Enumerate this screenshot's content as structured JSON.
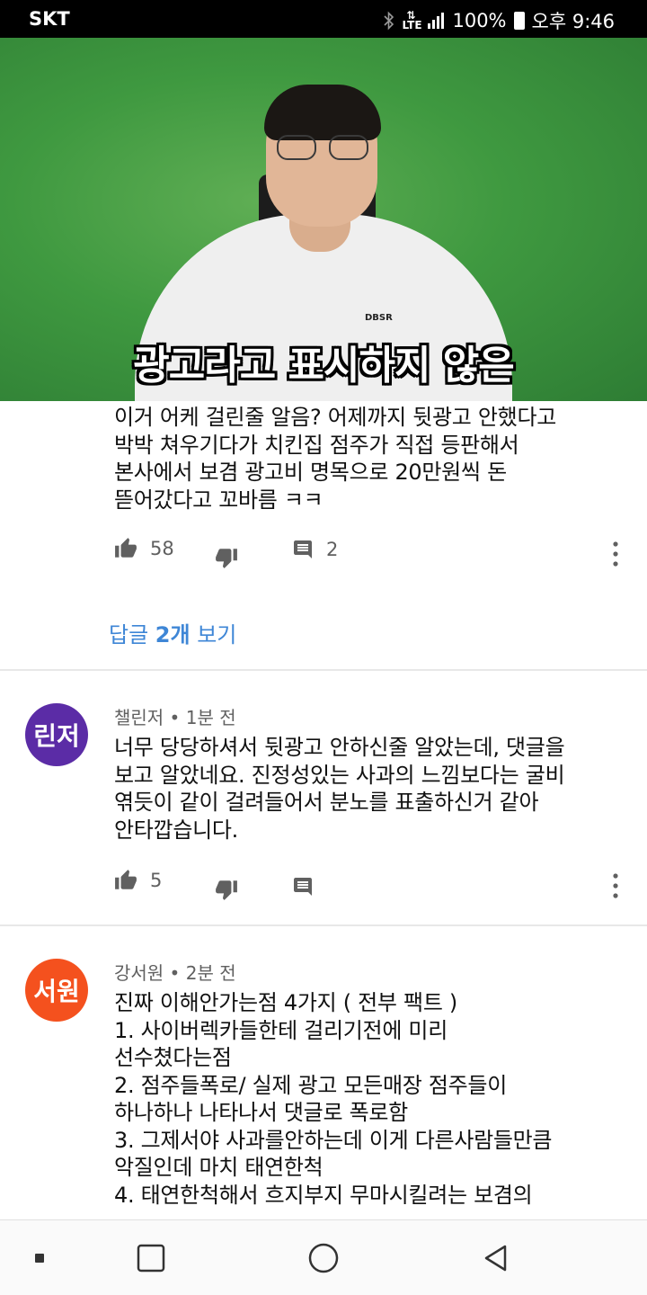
{
  "status_bar": {
    "carrier": "SKT",
    "battery": "100%",
    "time": "오후 9:46"
  },
  "video": {
    "caption": "광고라고 표시하지 않은",
    "shirt_logo": "DBSR",
    "progress_fraction": 0.08,
    "progress_color": "#ff0000"
  },
  "comments": [
    {
      "avatar_icon": "frog-avatar-icon",
      "text": "이거 어케 걸린줄 알음? 어제까지 뒷광고 안했다고\n박박 쳐우기다가 치킨집 점주가 직접 등판해서\n본사에서 보겸 광고비 명목으로 20만원씩 돈\n뜯어갔다고 꼬바름 ㅋㅋ",
      "likes": "58",
      "replies_count": "2",
      "view_replies_prefix": "답글 ",
      "view_replies_count": "2개",
      "view_replies_suffix": " 보기"
    },
    {
      "avatar_text": "린저",
      "avatar_color": "#5b2ca6",
      "author": "챌린저",
      "age": "1분 전",
      "text": "너무 당당하셔서 뒷광고 안하신줄 알았는데, 댓글을\n보고 알았네요. 진정성있는 사과의 느낌보다는 굴비\n엮듯이 같이 걸려들어서 분노를 표출하신거 같아\n안타깝습니다.",
      "likes": "5"
    },
    {
      "avatar_text": "서원",
      "avatar_color": "#f4511e",
      "author": "강서원",
      "age": "2분 전",
      "text": "진짜 이해안가는점 4가지 ( 전부 팩트 )\n1. 사이버렉카들한테 걸리기전에 미리\n선수쳤다는점\n2. 점주들폭로/ 실제 광고 모든매장 점주들이\n하나하나 나타나서 댓글로 폭로함\n3. 그제서야 사과를안하는데 이게 다른사람들만큼\n악질인데 마치 태연한척\n4. 태연한척해서 흐지부지 무마시킬려는 보겸의"
    }
  ],
  "meta_separator": " • ",
  "colors": {
    "link": "#3e86d6",
    "secondary_text": "#606060"
  }
}
